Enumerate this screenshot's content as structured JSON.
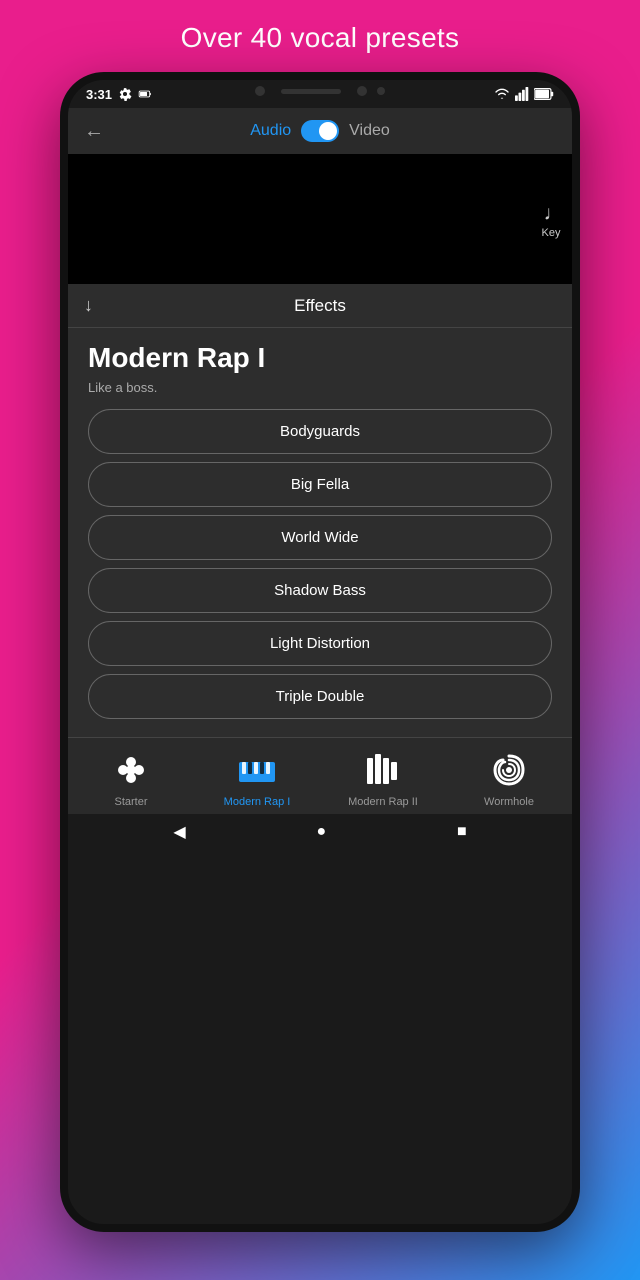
{
  "page": {
    "tagline": "Over 40 vocal presets"
  },
  "statusBar": {
    "time": "3:31"
  },
  "header": {
    "audioLabel": "Audio",
    "videoLabel": "Video",
    "backSymbol": "←"
  },
  "keyButton": {
    "label": "Key"
  },
  "effects": {
    "title": "Effects",
    "presetName": "Modern Rap I",
    "presetDesc": "Like a boss.",
    "buttons": [
      {
        "label": "Bodyguards"
      },
      {
        "label": "Big Fella"
      },
      {
        "label": "World Wide"
      },
      {
        "label": "Shadow Bass"
      },
      {
        "label": "Light Distortion"
      },
      {
        "label": "Triple Double"
      }
    ]
  },
  "bottomNav": {
    "items": [
      {
        "id": "starter",
        "label": "Starter",
        "active": false
      },
      {
        "id": "modern-rap-i",
        "label": "Modern Rap I",
        "active": true
      },
      {
        "id": "modern-rap-ii",
        "label": "Modern Rap II",
        "active": false
      },
      {
        "id": "wormhole",
        "label": "Wormhole",
        "active": false
      }
    ]
  },
  "systemNav": {
    "back": "◀",
    "home": "●",
    "recent": "■"
  }
}
